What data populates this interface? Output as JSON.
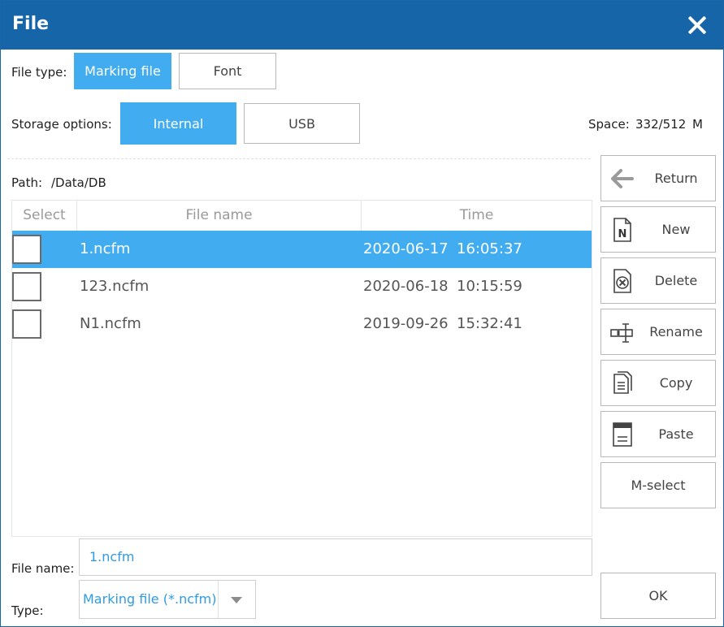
{
  "window": {
    "title": "File"
  },
  "file_type": {
    "label": "File type:",
    "options": [
      "Marking file",
      "Font"
    ],
    "selected": "Marking file"
  },
  "storage": {
    "label": "Storage options:",
    "options": [
      "Internal",
      "USB"
    ],
    "selected": "Internal"
  },
  "space": {
    "label": "Space:",
    "value": "332/512",
    "unit": "M"
  },
  "path": {
    "label": "Path:",
    "value": "/Data/DB"
  },
  "table": {
    "columns": [
      "Select",
      "File name",
      "Time"
    ],
    "rows": [
      {
        "name": "1.ncfm",
        "date": "2020-06-17",
        "time": "16:05:37",
        "selected": true
      },
      {
        "name": "123.ncfm",
        "date": "2020-06-18",
        "time": "10:15:59",
        "selected": false
      },
      {
        "name": "N1.ncfm",
        "date": "2019-09-26",
        "time": "15:32:41",
        "selected": false
      }
    ]
  },
  "actions": {
    "return": "Return",
    "new": "New",
    "delete": "Delete",
    "rename": "Rename",
    "copy": "Copy",
    "paste": "Paste",
    "mselect": "M-select",
    "ok": "OK"
  },
  "file_name": {
    "label": "File name:",
    "value": "1.ncfm"
  },
  "type": {
    "label": "Type:",
    "value": "Marking file (*.ncfm)"
  },
  "colors": {
    "title_bar": "#1565a8",
    "accent": "#41adf0",
    "input_text": "#2f9be0"
  }
}
